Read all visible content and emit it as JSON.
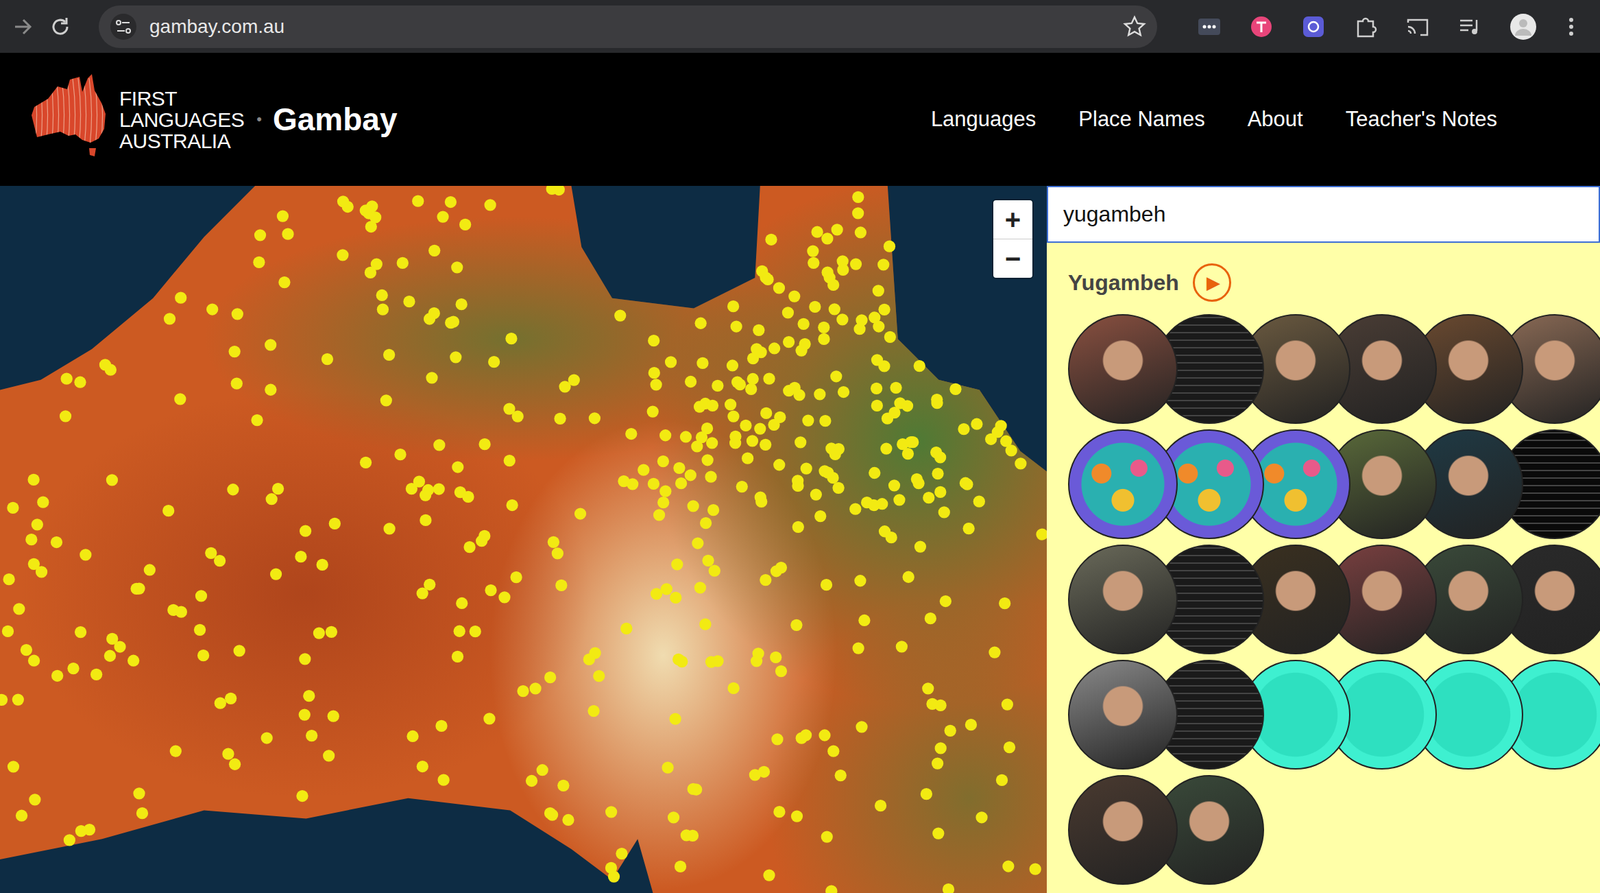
{
  "browser": {
    "url": "gambay.com.au"
  },
  "header": {
    "logo_lines": [
      "FIRST",
      "LANGUAGES",
      "AUSTRALIA"
    ],
    "separator": "•",
    "site_title": "Gambay",
    "nav": [
      "Languages",
      "Place Names",
      "About",
      "Teacher's Notes"
    ]
  },
  "map": {
    "zoom_in": "+",
    "zoom_out": "−"
  },
  "search": {
    "value": "yugambeh"
  },
  "result": {
    "title": "Yugambeh",
    "play": "▶",
    "thumbnail_rows": [
      [
        {
          "kind": "photo",
          "color": "#8a5040"
        },
        {
          "kind": "screen",
          "color": "#1a1a1a"
        },
        {
          "kind": "photo",
          "color": "#6b5a40"
        },
        {
          "kind": "photo",
          "color": "#4a3d35"
        },
        {
          "kind": "photo",
          "color": "#6b4a30"
        },
        {
          "kind": "photo",
          "color": "#8a6a55"
        }
      ],
      [
        {
          "kind": "pattern",
          "color": "#6a5ad8"
        },
        {
          "kind": "pattern",
          "color": "#6a5ad8"
        },
        {
          "kind": "pattern",
          "color": "#6a5ad8"
        },
        {
          "kind": "photo",
          "color": "#5a6a3a"
        },
        {
          "kind": "photo",
          "color": "#1f3a45"
        },
        {
          "kind": "screen",
          "color": "#0a0a0a"
        }
      ],
      [
        {
          "kind": "photo",
          "color": "#6a6a5a"
        },
        {
          "kind": "screen",
          "color": "#1a1a1a"
        },
        {
          "kind": "photo",
          "color": "#3a3020"
        },
        {
          "kind": "photo",
          "color": "#7a4040"
        },
        {
          "kind": "photo",
          "color": "#3a4a3a"
        },
        {
          "kind": "photo",
          "color": "#2a2a2a"
        }
      ],
      [
        {
          "kind": "photo",
          "color": "#8a8a8a"
        },
        {
          "kind": "screen",
          "color": "#1a1a1a"
        },
        {
          "kind": "teal",
          "color": "#2ee0c0"
        },
        {
          "kind": "teal",
          "color": "#2ee0c0"
        },
        {
          "kind": "teal",
          "color": "#2ee0c0"
        },
        {
          "kind": "teal",
          "color": "#2ee0c0"
        }
      ],
      [
        {
          "kind": "photo",
          "color": "#4a3a30"
        },
        {
          "kind": "photo",
          "color": "#3a4a3a"
        }
      ]
    ]
  }
}
